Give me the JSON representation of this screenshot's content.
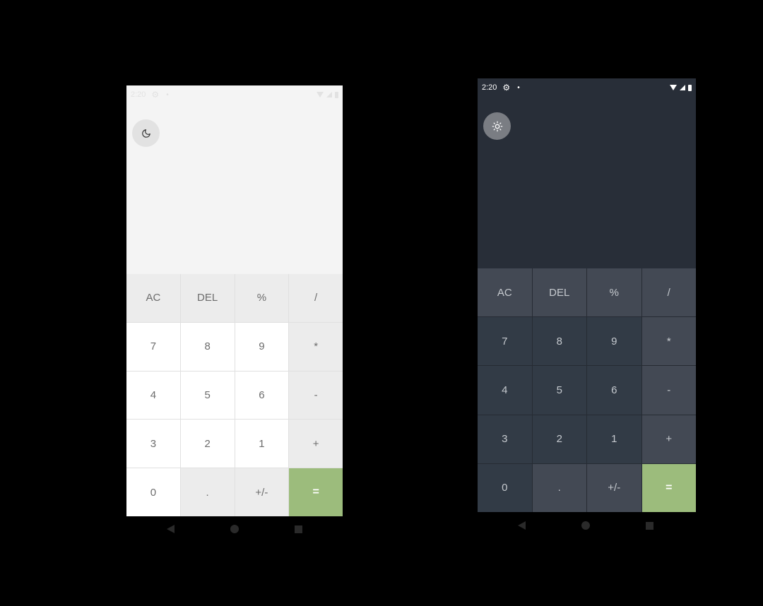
{
  "light": {
    "status": {
      "time": "2:20"
    },
    "theme_toggle": {
      "icon": "moon-icon"
    },
    "keys": [
      {
        "label": "AC",
        "kind": "op"
      },
      {
        "label": "DEL",
        "kind": "op"
      },
      {
        "label": "%",
        "kind": "op"
      },
      {
        "label": "/",
        "kind": "op"
      },
      {
        "label": "7",
        "kind": "num"
      },
      {
        "label": "8",
        "kind": "num"
      },
      {
        "label": "9",
        "kind": "num"
      },
      {
        "label": "*",
        "kind": "op"
      },
      {
        "label": "4",
        "kind": "num"
      },
      {
        "label": "5",
        "kind": "num"
      },
      {
        "label": "6",
        "kind": "num"
      },
      {
        "label": "-",
        "kind": "op"
      },
      {
        "label": "3",
        "kind": "num"
      },
      {
        "label": "2",
        "kind": "num"
      },
      {
        "label": "1",
        "kind": "num"
      },
      {
        "label": "+",
        "kind": "op"
      },
      {
        "label": "0",
        "kind": "num"
      },
      {
        "label": ".",
        "kind": "op"
      },
      {
        "label": "+/-",
        "kind": "op"
      },
      {
        "label": "=",
        "kind": "eq"
      }
    ]
  },
  "dark": {
    "status": {
      "time": "2:20"
    },
    "theme_toggle": {
      "icon": "sun-icon"
    },
    "keys": [
      {
        "label": "AC",
        "kind": "op"
      },
      {
        "label": "DEL",
        "kind": "op"
      },
      {
        "label": "%",
        "kind": "op"
      },
      {
        "label": "/",
        "kind": "op"
      },
      {
        "label": "7",
        "kind": "num"
      },
      {
        "label": "8",
        "kind": "num"
      },
      {
        "label": "9",
        "kind": "num"
      },
      {
        "label": "*",
        "kind": "op"
      },
      {
        "label": "4",
        "kind": "num"
      },
      {
        "label": "5",
        "kind": "num"
      },
      {
        "label": "6",
        "kind": "num"
      },
      {
        "label": "-",
        "kind": "op"
      },
      {
        "label": "3",
        "kind": "num"
      },
      {
        "label": "2",
        "kind": "num"
      },
      {
        "label": "1",
        "kind": "num"
      },
      {
        "label": "+",
        "kind": "op"
      },
      {
        "label": "0",
        "kind": "num"
      },
      {
        "label": ".",
        "kind": "op"
      },
      {
        "label": "+/-",
        "kind": "op"
      },
      {
        "label": "=",
        "kind": "eq"
      }
    ]
  },
  "colors": {
    "equals_accent": "#9cbc7c",
    "light_background": "#f4f4f4",
    "dark_background": "#282e38"
  },
  "navbar_icons": [
    "back-icon",
    "home-icon",
    "recents-icon"
  ]
}
